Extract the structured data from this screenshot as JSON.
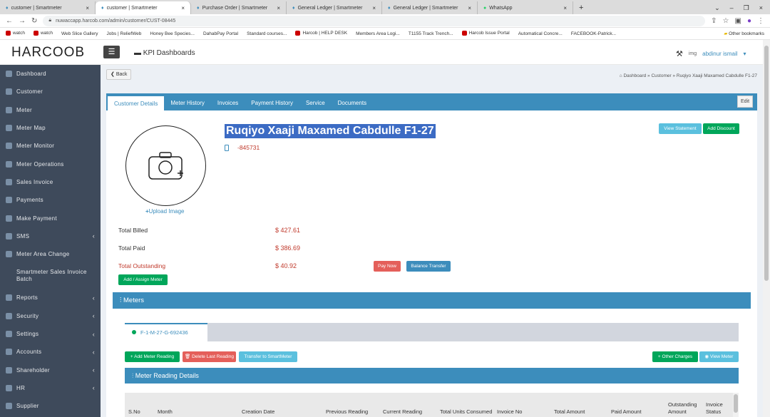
{
  "browser": {
    "tabs": [
      {
        "label": "customer | Smartmeter"
      },
      {
        "label": "customer | Smartmeter"
      },
      {
        "label": "Purchase Order | Smartmeter"
      },
      {
        "label": "General Ledger | Smartmeter"
      },
      {
        "label": "General Ledger | Smartmeter"
      },
      {
        "label": "WhatsApp"
      }
    ],
    "url": "nuwaccapp.harcob.com/admin/customer/CUST-08445",
    "bookmarks": [
      "watch",
      "watch",
      "Web Slice Gallery",
      "Jobs | ReliefWeb",
      "Honey Bee Species...",
      "DahabPay Portal",
      "Standard courses...",
      "Harcob | HELP DESK",
      "Members Area Logi...",
      "T1155 Track Trench...",
      "Harcob Issue Portal",
      "Automatical Concre...",
      "FACEBOOK-Patrick...",
      "Other bookmarks"
    ]
  },
  "header": {
    "logo": "HARCOOB",
    "menu_icon": "hamburger-icon",
    "page_title": "KPI Dashboards",
    "user_name": "abdinur ismail",
    "img_alt": "img"
  },
  "sidebar": {
    "items": [
      {
        "label": "Dashboard"
      },
      {
        "label": "Customer"
      },
      {
        "label": "Meter"
      },
      {
        "label": "Meter Map"
      },
      {
        "label": "Meter Monitor"
      },
      {
        "label": "Meter Operations"
      },
      {
        "label": "Sales Invoice"
      },
      {
        "label": "Payments"
      },
      {
        "label": "Make Payment"
      },
      {
        "label": "SMS",
        "chevron": "‹"
      },
      {
        "label": "Meter Area Change"
      },
      {
        "label": "Smartmeter Sales Invoice Batch"
      },
      {
        "label": "Reports",
        "chevron": "‹"
      },
      {
        "label": "Security",
        "chevron": "‹"
      },
      {
        "label": "Settings",
        "chevron": "‹"
      },
      {
        "label": "Accounts",
        "chevron": "‹"
      },
      {
        "label": "Shareholder",
        "chevron": "‹"
      },
      {
        "label": "HR",
        "chevron": "‹"
      },
      {
        "label": "Supplier"
      }
    ]
  },
  "page": {
    "back_label": "Back",
    "breadcrumb": [
      "Dashboard",
      "Customer",
      "Ruqiyo Xaaji Maxamed Cabdulle F1-27"
    ],
    "tabs": [
      "Customer Details",
      "Meter History",
      "Invoices",
      "Payment History",
      "Service",
      "Documents"
    ],
    "edit_label": "Edit",
    "customer_name": "Ruqiyo Xaaji Maxamed Cabdulle F1-27",
    "phone": "-845731",
    "upload_label": "Upload Image",
    "view_statement_label": "View Statement",
    "add_discount_label": "Add Discount",
    "total_billed_label": "Total Billed",
    "total_billed": "$ 427.61",
    "total_paid_label": "Total Paid",
    "total_paid": "$ 386.69",
    "total_outstanding_label": "Total Outstanding",
    "total_outstanding": "$ 40.92",
    "pay_now_label": "Pay Now",
    "balance_transfer_label": "Balance Transfer",
    "assign_meter_label": "Add / Assign Meter",
    "meters_heading": "Meters",
    "meter_tab": "F-1-M-27-G-692436",
    "add_reading_label": "Add Meter Reading",
    "delete_reading_label": "Delete Last Reading",
    "transfer_label": "Transfer to SmartMeter",
    "other_charges_label": "Other Charges",
    "view_meter_label": "View Meter",
    "reading_heading": "Meter Reading Details",
    "table_headers": [
      "S.No",
      "Month",
      "Creation Date",
      "Previous Reading",
      "Current Reading",
      "Total Units Consumed",
      "Invoice No",
      "Total Amount",
      "Paid Amount",
      "Outstanding Amount",
      "Invoice Status"
    ]
  }
}
